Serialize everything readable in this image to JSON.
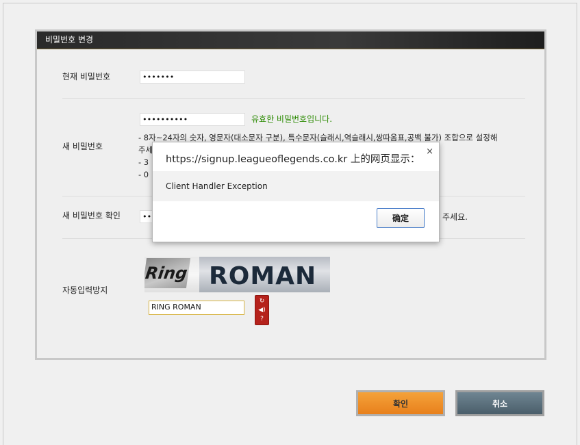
{
  "panel": {
    "title": "비밀번호 변경"
  },
  "form": {
    "current_label": "현재 비밀번호",
    "current_value": "•••••••",
    "new_label": "새 비밀번호",
    "new_value": "••••••••••",
    "valid_message": "유효한 비밀번호입니다.",
    "rules": [
      "- 8자~24자의 숫자, 영문자(대소문자 구분), 특수문자(슬래시,역슬래시,쌍따옴표,공백 불가) 조합으로 설정해",
      "주세",
      "- 3",
      "- 0"
    ],
    "confirm_label": "새 비밀번호 확인",
    "confirm_value": "•••",
    "confirm_hint_tail": "주세요.",
    "captcha_label": "자동입력방지",
    "captcha_word1": "Ring",
    "captcha_word2": "ROMAN",
    "captcha_value": "RING ROMAN"
  },
  "captcha_tools": {
    "refresh_icon": "↻",
    "audio_icon": "◀)",
    "help_icon": "?"
  },
  "buttons": {
    "ok": "확인",
    "cancel": "취소"
  },
  "dialog": {
    "title": "https://signup.leagueoflegends.co.kr 上的网页显示：",
    "close": "×",
    "message": "Client Handler Exception",
    "ok": "确定"
  }
}
